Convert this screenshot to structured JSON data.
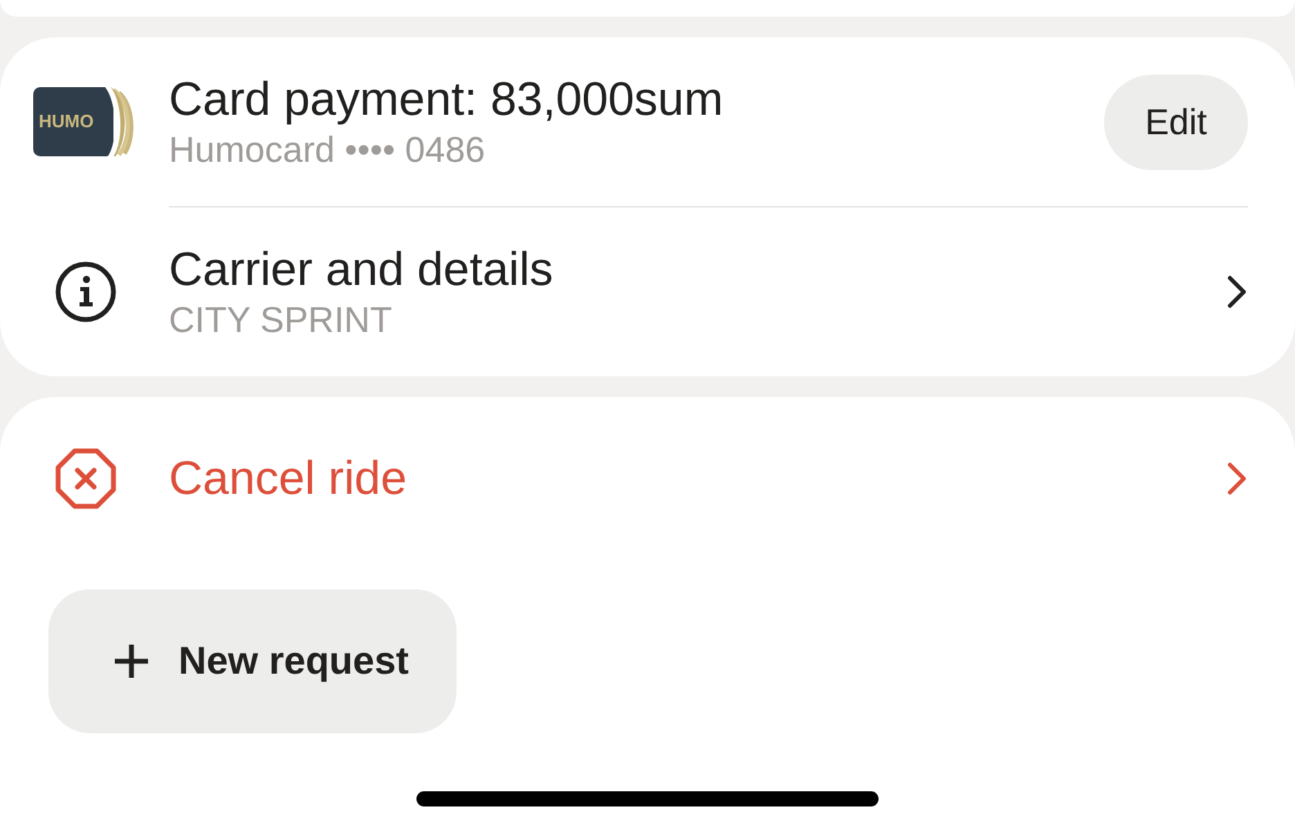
{
  "payment": {
    "card_logo": "HUMO",
    "title": "Card payment: 83,000sum",
    "subtitle": "Humocard •••• 0486",
    "edit_button": "Edit"
  },
  "details": {
    "title": "Carrier and details",
    "subtitle": "CITY SPRINT"
  },
  "cancel": {
    "label": "Cancel ride"
  },
  "new_request": {
    "label": "New request"
  }
}
